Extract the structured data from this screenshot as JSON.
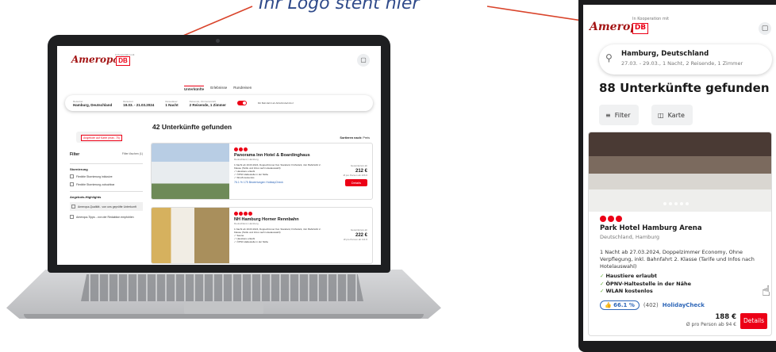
{
  "caption": "Ihr Logo steht hier",
  "colors": {
    "brand_red": "#ec0016",
    "logo_red": "#a31414",
    "link_blue": "#2f67b8",
    "check_green": "#6cb33f"
  },
  "laptop": {
    "logo": "Ameropa",
    "partner_text": "In Kooperation mit",
    "db_label": "DB",
    "tabs": [
      "Unterkünfte",
      "Erlebnisse",
      "Rundreisen"
    ],
    "search": {
      "reiseziel_label": "Reiseziel",
      "reiseziel": "Hamburg, Deutschland",
      "reisezeit_label": "Reisezeit",
      "reisezeit": "19.03. - 21.03.2024",
      "reisedauer_label": "Reisedauer",
      "reisedauer": "1 Nacht",
      "personen_label": "Reisende, Zimmeranzahl",
      "personen": "2 Reisende, 1 Zimmer",
      "bahn_info": "Mit Bahnfahrt ab Abfahrtsbahnhof"
    },
    "note": "Angebote auf Karte (max. 75)",
    "result_count": "42 Unterkünfte gefunden",
    "sort_label": "Sortieren nach:",
    "sort_value": "Preis",
    "filter": {
      "title": "Filter",
      "reset": "Filter löschen (1)",
      "groups": [
        {
          "heading": "Stornierung",
          "options": [
            "Flexible Stornierung inklusive",
            "Flexible Stornierung zubuchbar"
          ]
        },
        {
          "heading": "Angebots-Highlights",
          "options": [
            "Ameropa-Qualität - von uns geprüfte Unterkunft",
            "Ameropa-Tipps - von der Redaktion empfohlen"
          ]
        }
      ]
    },
    "hotels": [
      {
        "name": "Panorama Inn Hotel & Boardinghaus",
        "location": "Deutschland, Hamburg",
        "description": "1 Nacht ab 19.03.2024, Doppelzimmer Kat. Standard, Frühstück, inkl. Bahnfahrt 2. Klasse (Tarife und Infos nach Hotelauswahl)",
        "amenities": [
          "Haustiere erlaubt",
          "ÖPNV-Haltestelle in der Nähe",
          "WLAN kostenlos"
        ],
        "rating": "76.1 %",
        "reviews": "175 Bewertungen",
        "rating_source": "HolidayCheck",
        "price_label": "Gesamtpreis ab",
        "price": "212 €",
        "per_person": "Ø pro Person ab 106 €",
        "button": "Details"
      },
      {
        "name": "NH Hamburg Horner Rennbahn",
        "location": "Deutschland, Hamburg",
        "description": "1 Nacht ab 19.03.2024, Doppelzimmer Kat. Standard, Frühstück, inkl. Bahnfahrt 2. Klasse (Tarife und Infos nach Hotelauswahl)",
        "amenities": [
          "Sauna",
          "Haustiere erlaubt",
          "ÖPNV-Haltestelle in der Nähe"
        ],
        "price_label": "Gesamtpreis ab",
        "price": "222 €",
        "per_person": "Ø pro Person ab 111 €"
      }
    ]
  },
  "phone": {
    "logo": "Ameropa",
    "partner_text": "In Kooperation mit",
    "db_label": "DB",
    "search_location": "Hamburg, Deutschland",
    "search_details": "27.03. - 29.03., 1 Nacht, 2 Reisende, 1 Zimmer",
    "result_count": "88 Unterkünfte gefunden",
    "filter_label": "Filter",
    "map_label": "Karte",
    "hotel": {
      "name": "Park Hotel Hamburg Arena",
      "location": "Deutschland, Hamburg",
      "description": "1 Nacht ab 27.03.2024, Doppelzimmer Economy, Ohne Verpflegung, inkl. Bahnfahrt 2. Klasse (Tarife und Infos nach Hotelauswahl)",
      "amenities": [
        "Haustiere erlaubt",
        "ÖPNV-Haltestelle in der Nähe",
        "WLAN kostenlos"
      ],
      "rating": "66.1 %",
      "reviews": "(402)",
      "rating_source": "HolidayCheck",
      "price": "188 €",
      "per_person": "Ø pro Person ab 94 €",
      "button": "Details"
    }
  }
}
